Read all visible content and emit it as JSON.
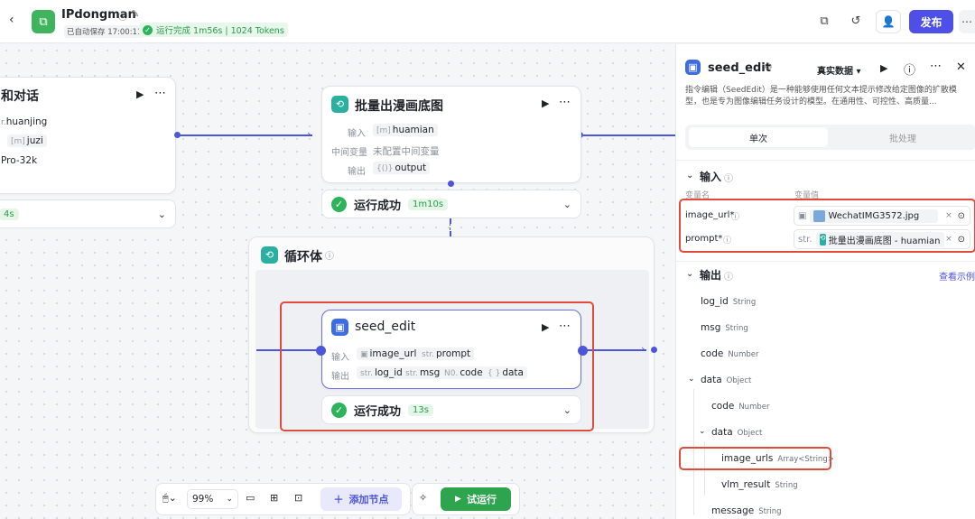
{
  "header": {
    "back_icon": "chevron-left-icon",
    "app_name": "IPdongman",
    "autosave": "已自动保存 17:00:11",
    "run_status": "运行完成 1m56s | 1024 Tokens",
    "publish_label": "发布"
  },
  "nodes": {
    "left_node": {
      "title": "和对话",
      "var1_prefix": "r.",
      "var1": "huanjing",
      "var2_prefix": "[m]",
      "var2": "juzi",
      "model": "Pro-32k",
      "time": "4s"
    },
    "batch_node": {
      "title": "批量出漫画底图",
      "input_label": "输入",
      "input_prefix": "[m]",
      "input_var": "huamian",
      "mid_label": "中间变量",
      "mid_value": "未配置中间变量",
      "output_label": "输出",
      "output_prefix": "{()}",
      "output_var": "output",
      "status": "运行成功",
      "time": "1m10s"
    },
    "loop_node": {
      "title": "循环体"
    },
    "seed_node": {
      "title": "seed_edit",
      "input_label": "输入",
      "inputs": [
        {
          "prefix": "▣",
          "name": "image_url"
        },
        {
          "prefix": "str.",
          "name": "prompt"
        }
      ],
      "output_label": "输出",
      "outputs": [
        {
          "prefix": "str.",
          "name": "log_id"
        },
        {
          "prefix": "str.",
          "name": "msg"
        },
        {
          "prefix": "N0.",
          "name": "code"
        },
        {
          "prefix": "{ }",
          "name": "data"
        }
      ],
      "status": "运行成功",
      "time": "13s"
    }
  },
  "toolbar": {
    "zoom": "99%",
    "add_node": "添加节点",
    "test_run": "试运行"
  },
  "panel": {
    "title": "seed_edit",
    "data_mode": "真实数据",
    "description": "指令编辑（SeedEdit）是一种能够使用任何文本提示修改给定图像的扩散模型，也是专为图像编辑任务设计的模型。在通用性、可控性、高质量...",
    "tabs": [
      "单次",
      "批处理"
    ],
    "input_section": "输入",
    "col_name": "变量名",
    "col_value": "变量值",
    "inputs": [
      {
        "name": "image_url*",
        "prefix": "▣",
        "value": "WechatIMG3572.jpg"
      },
      {
        "name": "prompt*",
        "prefix": "str.",
        "value": "批量出漫画底图 - huamian"
      }
    ],
    "output_section": "输出",
    "view_example": "查看示例",
    "outputs": [
      {
        "name": "log_id",
        "type": "String"
      },
      {
        "name": "msg",
        "type": "String"
      },
      {
        "name": "code",
        "type": "Number"
      },
      {
        "name": "data",
        "type": "Object"
      },
      {
        "name": "code",
        "type": "Number"
      },
      {
        "name": "data",
        "type": "Object"
      },
      {
        "name": "image_urls",
        "type": "Array<String>"
      },
      {
        "name": "vlm_result",
        "type": "String"
      },
      {
        "name": "message",
        "type": "String"
      }
    ]
  },
  "colors": {
    "accent": "#4d55d9",
    "success": "#2db45a",
    "highlight": "#e24a3b",
    "publish": "#4d4fe6"
  }
}
